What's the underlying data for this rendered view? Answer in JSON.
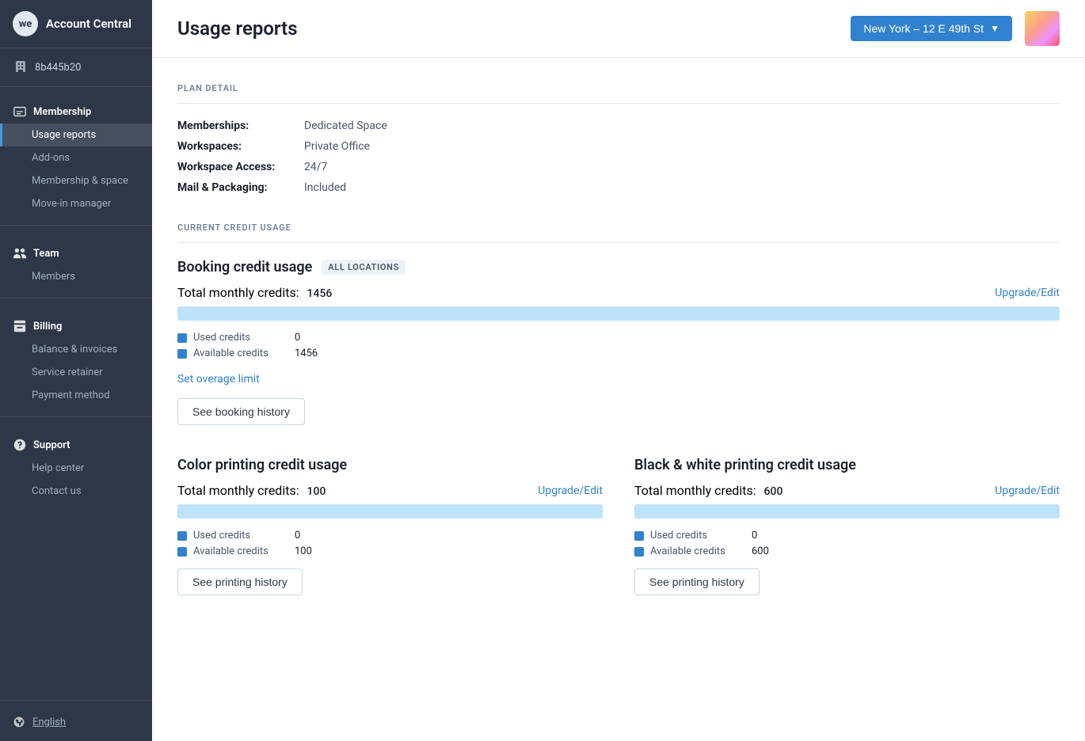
{
  "sidebar": {
    "logo_text": "Account Central",
    "logo_initials": "we",
    "account_id": "8b445b20",
    "sections": [
      {
        "id": "membership",
        "label": "Membership",
        "icon": "membership-icon",
        "items": [
          {
            "id": "usage-reports",
            "label": "Usage reports",
            "active": true
          },
          {
            "id": "add-ons",
            "label": "Add-ons",
            "active": false
          },
          {
            "id": "membership-space",
            "label": "Membership & space",
            "active": false
          },
          {
            "id": "move-in-manager",
            "label": "Move-in manager",
            "active": false
          }
        ]
      },
      {
        "id": "team",
        "label": "Team",
        "icon": "team-icon",
        "items": [
          {
            "id": "members",
            "label": "Members",
            "active": false
          }
        ]
      },
      {
        "id": "billing",
        "label": "Billing",
        "icon": "billing-icon",
        "items": [
          {
            "id": "balance-invoices",
            "label": "Balance & invoices",
            "active": false
          },
          {
            "id": "service-retainer",
            "label": "Service retainer",
            "active": false
          },
          {
            "id": "payment-method",
            "label": "Payment method",
            "active": false
          }
        ]
      },
      {
        "id": "support",
        "label": "Support",
        "icon": "support-icon",
        "items": [
          {
            "id": "help-center",
            "label": "Help center",
            "active": false
          },
          {
            "id": "contact-us",
            "label": "Contact us",
            "active": false
          }
        ]
      }
    ],
    "footer": {
      "language": "English"
    }
  },
  "header": {
    "page_title": "Usage reports",
    "location_label": "New York – 12 E 49th St"
  },
  "plan_detail": {
    "section_label": "PLAN DETAIL",
    "rows": [
      {
        "label": "Memberships:",
        "value": "Dedicated Space"
      },
      {
        "label": "Workspaces:",
        "value": "Private Office"
      },
      {
        "label": "Workspace Access:",
        "value": "24/7"
      },
      {
        "label": "Mail & Packaging:",
        "value": "Included"
      }
    ]
  },
  "current_credit_usage": {
    "section_label": "CURRENT CREDIT USAGE",
    "booking": {
      "title": "Booking credit usage",
      "badge": "ALL LOCATIONS",
      "total_label": "Total monthly credits:",
      "total_value": "1456",
      "upgrade_label": "Upgrade/Edit",
      "used_credits": 0,
      "available_credits": 1456,
      "used_label": "Used credits",
      "available_label": "Available credits",
      "overage_label": "Set overage limit",
      "history_label": "See booking history",
      "progress_pct": 0
    },
    "color_printing": {
      "title": "Color printing credit usage",
      "total_label": "Total monthly credits:",
      "total_value": "100",
      "upgrade_label": "Upgrade/Edit",
      "used_credits": 0,
      "available_credits": 100,
      "used_label": "Used credits",
      "available_label": "Available credits",
      "history_label": "See printing history",
      "progress_pct": 0
    },
    "bw_printing": {
      "title": "Black & white printing credit usage",
      "total_label": "Total monthly credits:",
      "total_value": "600",
      "upgrade_label": "Upgrade/Edit",
      "used_credits": 0,
      "available_credits": 600,
      "used_label": "Used credits",
      "available_label": "Available credits",
      "history_label": "See printing history",
      "progress_pct": 0
    }
  }
}
